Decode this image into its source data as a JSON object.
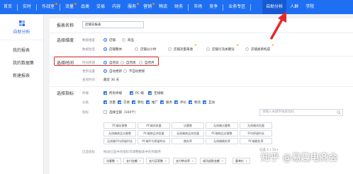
{
  "topnav": {
    "items": [
      "首页",
      "实时",
      "作战室",
      "流量",
      "品类",
      "交易",
      "内容",
      "服务",
      "营销",
      "物流",
      "财务",
      "市场",
      "竞争",
      "业务专区",
      "自助分析",
      "人群",
      "学院"
    ],
    "active": "自助分析"
  },
  "sidebar": {
    "title": "自助分析",
    "items": [
      "我的报表",
      "我的数据集",
      "新建报表"
    ]
  },
  "form": {
    "report_name_label": "报表名称",
    "report_name_value": "店铺日报表",
    "dimension_label": "选择维度",
    "dimension_sub1": "数据维度",
    "dimension_opt1": "店铺",
    "dimension_opt2": "商品",
    "dimension_sub2": "数据粒度",
    "granularity": [
      "店铺整体",
      "店铺分小时",
      "店铺流量来源",
      "店铺引流关键词",
      "店铺类目构成"
    ],
    "time_label": "选择时间",
    "time_sub1": "时间周期",
    "time_options": [
      "自然日",
      "自然周",
      "自然月"
    ],
    "time_sub2": "更新设置",
    "update_opt1": "自动更新",
    "update_opt2": "不自动更新",
    "time_sub3": "查询时间",
    "query_time": "最近 30 天",
    "metric_label": "选择指标",
    "metric_sub1": "终端",
    "terminals": [
      "所有终端",
      "PC 端",
      "无线端"
    ],
    "metric_sub2": "分类",
    "categories": [
      "流量",
      "交易",
      "转化",
      "推广",
      "服务",
      "评价",
      "物流",
      "互动"
    ],
    "metric_sub3": "指标",
    "select_all": "选择全部（104个）",
    "search_placeholder": "请输入关键字搜索指标",
    "metrics": [
      [
        "PC端访客数",
        "PC端浏览量",
        "访客数",
        "无线端访客数",
        "无线端浏览量"
      ],
      [
        "无线端商品访客数",
        "PC端商品浏览量",
        "无线端商品浏览量",
        "PC端商品访客数",
        "平均停留时长"
      ],
      [
        "无线端平均停留时长",
        "PC端平均停留时长",
        "跳失率",
        "无线端跳失率",
        "PC端跳失率"
      ]
    ],
    "selected_sub": "已选指标",
    "selected_hint": "拖动已选中的指标可调整报表中的列顺序",
    "selected_chips": [
      "访客数",
      "支付金额",
      "支付买家数",
      "支付转化率",
      "成功退款金额",
      "客单价"
    ],
    "pager": "已选 1 / 10+"
  },
  "watermark": "知乎 @易趣电商会",
  "colors": {
    "nav": "#1f6ff2",
    "accent": "#2a6ee8",
    "highlight": "#e52a2a",
    "star": "#f4b400"
  }
}
